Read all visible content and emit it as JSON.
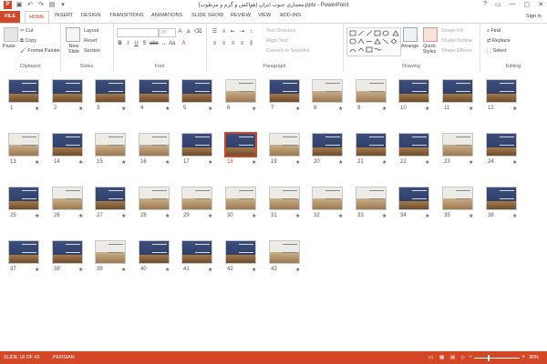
{
  "window": {
    "title": "معماری جنوب ایران (هواکش و گرم و مرطوب).pptx - PowerPoint",
    "sign_in": "Sign in",
    "controls": [
      "?",
      "▭",
      "—",
      "▢",
      "✕"
    ]
  },
  "tabs": [
    "FILE",
    "HOME",
    "INSERT",
    "DESIGN",
    "TRANSITIONS",
    "ANIMATIONS",
    "SLIDE SHOW",
    "REVIEW",
    "VIEW",
    "ADD-INS"
  ],
  "active_tab": "HOME",
  "ribbon": {
    "clipboard": {
      "label": "Clipboard",
      "paste": "Paste",
      "cut": "Cut",
      "copy": "Copy",
      "format_painter": "Format Painter"
    },
    "slides": {
      "label": "Slides",
      "new_slide": "New Slide",
      "layout": "Layout",
      "reset": "Reset",
      "section": "Section"
    },
    "font": {
      "label": "Font",
      "size": "28"
    },
    "paragraph": {
      "label": "Paragraph",
      "text_direction": "Text Direction",
      "align_text": "Align Text",
      "convert_smartart": "Convert to SmartArt"
    },
    "drawing": {
      "label": "Drawing",
      "arrange": "Arrange",
      "quick_styles": "Quick Styles",
      "shape_fill": "Shape Fill",
      "shape_outline": "Shape Outline",
      "shape_effects": "Shape Effects"
    },
    "editing": {
      "label": "Editing",
      "find": "Find",
      "replace": "Replace",
      "select": "Select"
    }
  },
  "slides": [
    {
      "n": "1"
    },
    {
      "n": "2"
    },
    {
      "n": "3"
    },
    {
      "n": "4"
    },
    {
      "n": "5"
    },
    {
      "n": "6"
    },
    {
      "n": "7"
    },
    {
      "n": "8"
    },
    {
      "n": "9"
    },
    {
      "n": "10"
    },
    {
      "n": "11"
    },
    {
      "n": "12"
    },
    {
      "n": "13"
    },
    {
      "n": "14"
    },
    {
      "n": "15"
    },
    {
      "n": "16"
    },
    {
      "n": "17"
    },
    {
      "n": "18"
    },
    {
      "n": "19"
    },
    {
      "n": "20"
    },
    {
      "n": "21"
    },
    {
      "n": "22"
    },
    {
      "n": "23"
    },
    {
      "n": "24"
    },
    {
      "n": "25"
    },
    {
      "n": "26"
    },
    {
      "n": "27"
    },
    {
      "n": "28"
    },
    {
      "n": "29"
    },
    {
      "n": "30"
    },
    {
      "n": "31"
    },
    {
      "n": "32"
    },
    {
      "n": "33"
    },
    {
      "n": "34"
    },
    {
      "n": "35"
    },
    {
      "n": "36"
    },
    {
      "n": "37"
    },
    {
      "n": "38"
    },
    {
      "n": "39"
    },
    {
      "n": "40"
    },
    {
      "n": "41"
    },
    {
      "n": "42"
    },
    {
      "n": "43"
    }
  ],
  "selected_slide": "18",
  "star_glyph": "★",
  "status": {
    "slide_info": "SLIDE 18 OF 43",
    "language": "PERSIAN",
    "zoom": "30%",
    "zoom_minus": "−",
    "zoom_plus": "+"
  },
  "colors": {
    "accent": "#d24726"
  }
}
